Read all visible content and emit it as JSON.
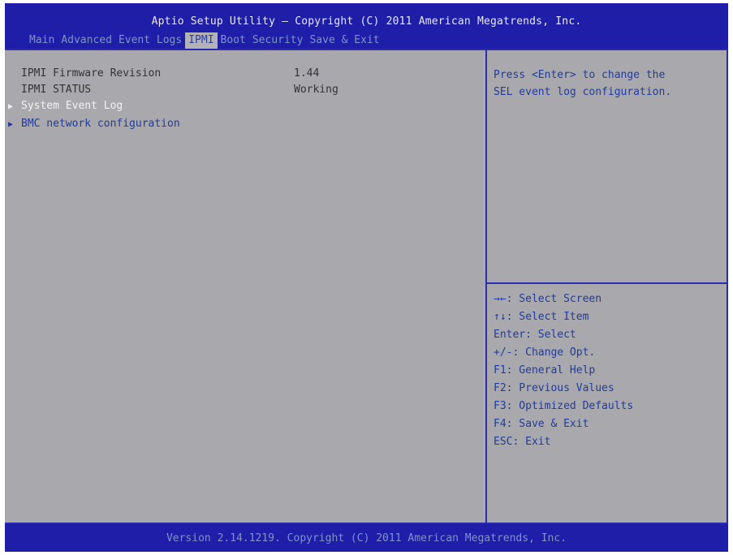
{
  "header": {
    "title": "Aptio Setup Utility – Copyright (C) 2011 American Megatrends, Inc.",
    "tabs": [
      {
        "label": "Main",
        "active": false
      },
      {
        "label": "Advanced",
        "active": false
      },
      {
        "label": "Event Logs",
        "active": false
      },
      {
        "label": "IPMI",
        "active": true
      },
      {
        "label": "Boot",
        "active": false
      },
      {
        "label": "Security",
        "active": false
      },
      {
        "label": "Save & Exit",
        "active": false
      }
    ]
  },
  "main": {
    "rows": [
      {
        "label": "IPMI Firmware Revision",
        "value": "1.44"
      },
      {
        "label": "IPMI STATUS",
        "value": "Working"
      }
    ],
    "submenus": [
      {
        "label": "System Event Log",
        "selected": true
      },
      {
        "label": "BMC network configuration",
        "selected": false
      }
    ]
  },
  "help": {
    "text": "Press <Enter> to change the\nSEL event log configuration.",
    "keys": [
      "→←: Select Screen",
      "↑↓: Select Item",
      "Enter: Select",
      "+/-: Change Opt.",
      "F1: General Help",
      "F2: Previous Values",
      "F3: Optimized Defaults",
      "F4: Save & Exit",
      "ESC: Exit"
    ]
  },
  "footer": {
    "text": "Version 2.14.1219. Copyright (C) 2011 American Megatrends, Inc."
  },
  "colors": {
    "header_bg": "#1e1ea8",
    "panel_bg": "#a9a9ad",
    "border": "#2b2bb0",
    "selected_text": "#f2f2f2",
    "help_text": "#223a9a"
  }
}
